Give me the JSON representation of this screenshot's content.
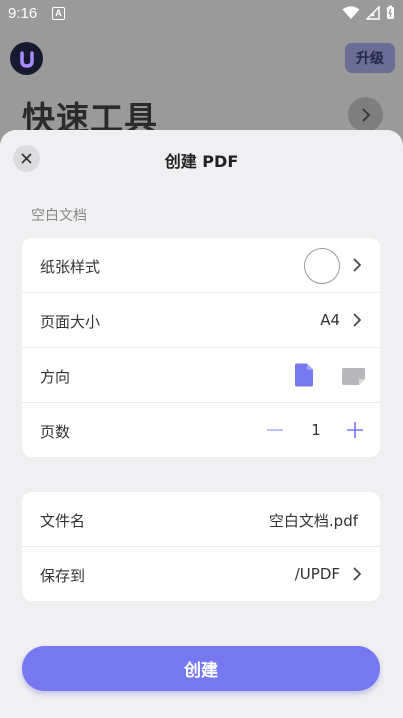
{
  "status_bar": {
    "time": "9:16",
    "notification_letter": "A"
  },
  "background": {
    "upgrade_label": "升级",
    "title": "快速工具"
  },
  "sheet": {
    "title": "创建 PDF",
    "section_label": "空白文档",
    "rows": {
      "paper_style": {
        "label": "纸张样式"
      },
      "page_size": {
        "label": "页面大小",
        "value": "A4"
      },
      "orientation": {
        "label": "方向",
        "selected": "portrait"
      },
      "page_count": {
        "label": "页数",
        "value": "1"
      },
      "file_name": {
        "label": "文件名",
        "value": "空白文档.pdf"
      },
      "save_to": {
        "label": "保存到",
        "value": "/UPDF"
      }
    },
    "create_label": "创建"
  },
  "colors": {
    "accent": "#7678f0",
    "landscape_inactive": "#b8b8bc"
  }
}
